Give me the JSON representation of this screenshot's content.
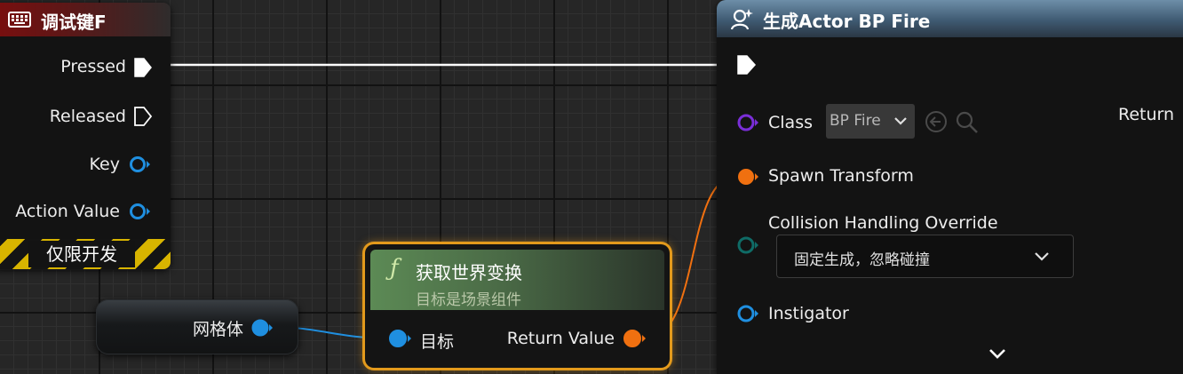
{
  "input_node": {
    "title": "调试键F",
    "icon": "keyboard-icon",
    "pins": {
      "pressed": "Pressed",
      "released": "Released",
      "key": "Key",
      "action_value": "Action Value"
    },
    "dev_only": "仅限开发"
  },
  "spawn_node": {
    "title": "生成Actor BP Fire",
    "icon": "spawn-actor-icon",
    "class_label": "Class",
    "class_value": "BP Fire",
    "spawn_transform_label": "Spawn Transform",
    "collision_label": "Collision Handling Override",
    "collision_value": "固定生成，忽略碰撞",
    "instigator_label": "Instigator",
    "return_label": "Return"
  },
  "mesh_node": {
    "label": "网格体"
  },
  "func_node": {
    "icon": "function-icon",
    "title": "获取世界变换",
    "subtitle": "目标是场景组件",
    "target_label": "目标",
    "return_label": "Return Value"
  },
  "colors": {
    "exec": "#ffffff",
    "object_pin": "#1f8fe0",
    "class_pin": "#7a2ed8",
    "struct_pin": "#f07010",
    "highlight": "#e39a1c"
  }
}
